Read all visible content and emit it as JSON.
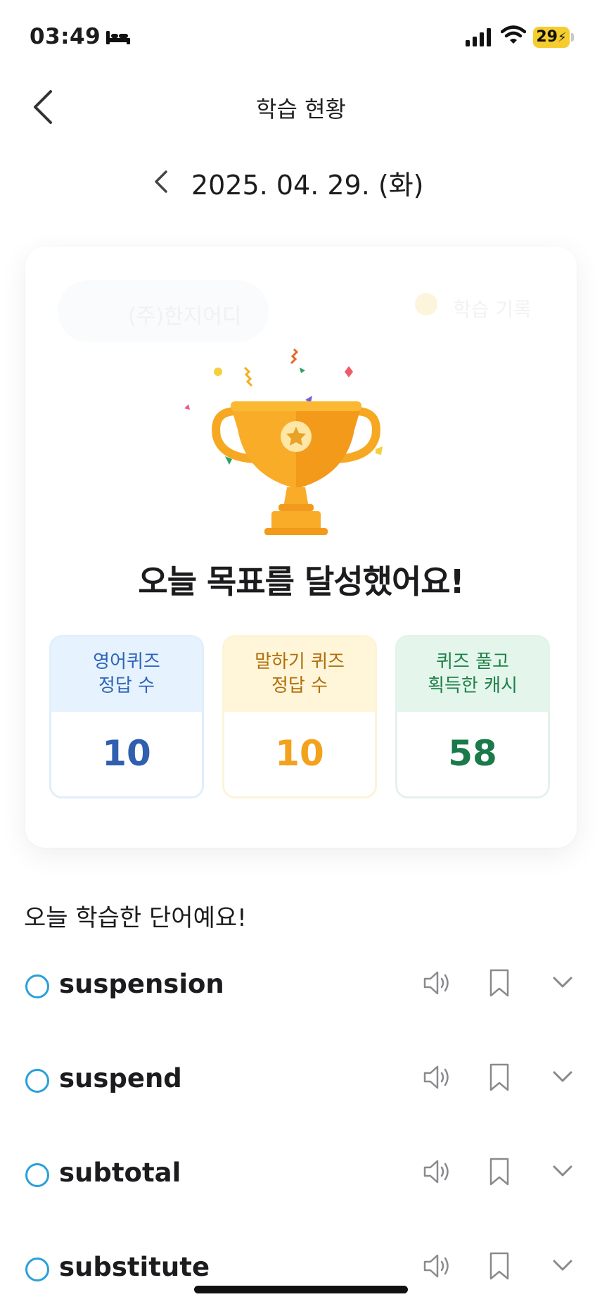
{
  "status_bar": {
    "time": "03:49",
    "battery": "29"
  },
  "nav": {
    "title": "학습 현황"
  },
  "date_selector": {
    "date": "2025. 04. 29. (화)"
  },
  "summary_card": {
    "faded_left_label": "(주)한지어디",
    "faded_right_label": "학습 기록",
    "headline": "오늘 목표를 달성했어요!",
    "stats": [
      {
        "label_line1": "영어퀴즈",
        "label_line2": "정답 수",
        "value": "10",
        "color": "#2f5fae"
      },
      {
        "label_line1": "말하기 퀴즈",
        "label_line2": "정답 수",
        "value": "10",
        "color": "#f2a21c"
      },
      {
        "label_line1": "퀴즈 풀고",
        "label_line2": "획득한 캐시",
        "value": "58",
        "color": "#1a7a4a"
      }
    ]
  },
  "word_list": {
    "title": "오늘 학습한 단어예요!",
    "items": [
      {
        "word": "suspension"
      },
      {
        "word": "suspend"
      },
      {
        "word": "subtotal"
      },
      {
        "word": "substitute"
      }
    ]
  },
  "colors": {
    "accent_blue": "#29a0dc",
    "trophy_gold": "#f7a823"
  }
}
